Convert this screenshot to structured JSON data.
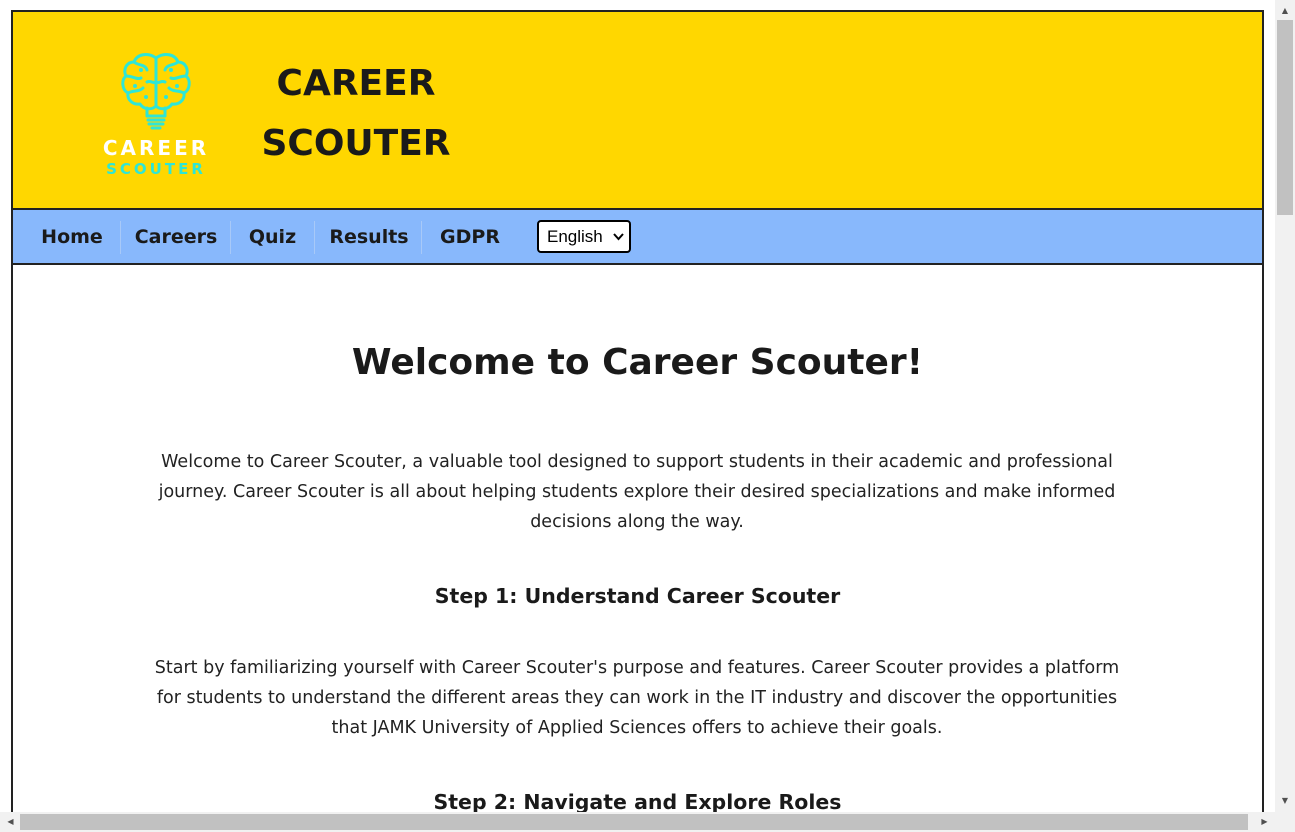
{
  "header": {
    "logo": {
      "line1": "CAREER",
      "line2": "SCOUTER",
      "icon": "brain-lightbulb-icon",
      "colors": {
        "icon": "#2ee6d6",
        "line1": "#ffffff",
        "line2": "#2ee6d6"
      }
    },
    "title_line1": "CAREER",
    "title_line2": "SCOUTER",
    "background": "#ffd700"
  },
  "nav": {
    "background": "#88b8fc",
    "items": [
      {
        "label": "Home"
      },
      {
        "label": "Careers"
      },
      {
        "label": "Quiz"
      },
      {
        "label": "Results"
      },
      {
        "label": "GDPR"
      }
    ],
    "language_select": {
      "value": "English",
      "icon": "chevron-down-icon"
    }
  },
  "main": {
    "heading": "Welcome to Career Scouter!",
    "intro": "Welcome to Career Scouter, a valuable tool designed to support students in their academic and professional journey. Career Scouter is all about helping students explore their desired specializations and make informed decisions along the way.",
    "step1_title": "Step 1: Understand Career Scouter",
    "step1_text": "Start by familiarizing yourself with Career Scouter's purpose and features. Career Scouter provides a platform for students to understand the different areas they can work in the IT industry and discover the opportunities that JAMK University of Applied Sciences offers to achieve their goals.",
    "step2_title": "Step 2: Navigate and Explore Roles"
  }
}
